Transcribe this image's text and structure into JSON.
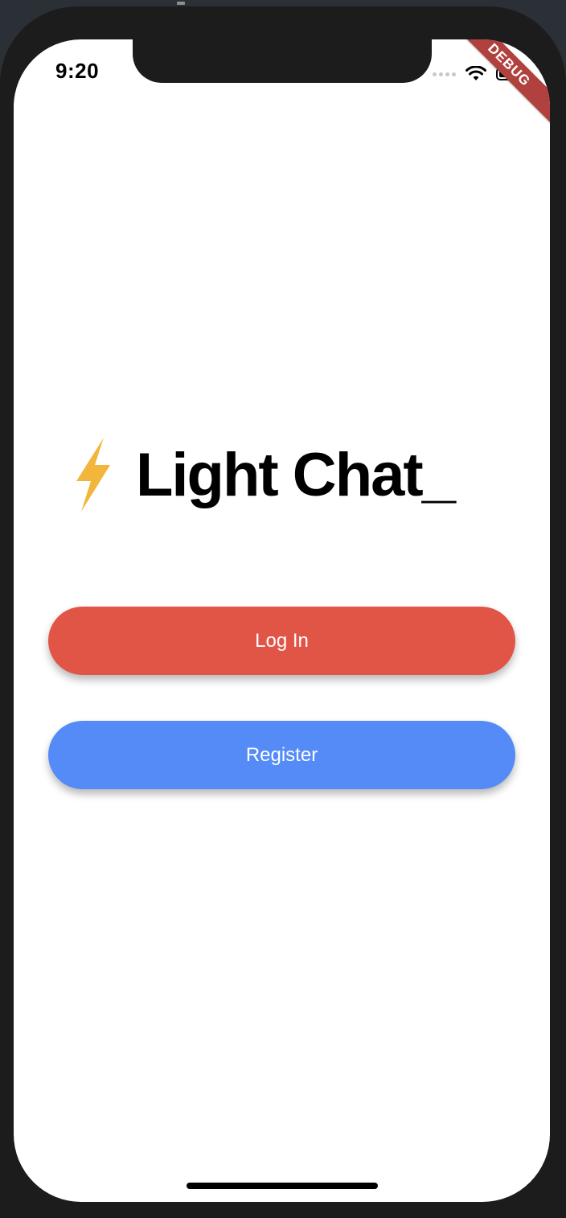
{
  "status_bar": {
    "time": "9:20",
    "battery_level": 0.8,
    "icons": [
      "signal-dots-icon",
      "wifi-icon",
      "battery-icon"
    ]
  },
  "debug_banner": {
    "label": "DEBUG",
    "color": "#b0413e"
  },
  "brand": {
    "icon": "lightning-bolt-icon",
    "title": "Light Chat_"
  },
  "actions": {
    "login_label": "Log In",
    "register_label": "Register"
  },
  "colors": {
    "login": "#e05545",
    "register": "#548bf7",
    "bolt": "#f2b63c"
  }
}
